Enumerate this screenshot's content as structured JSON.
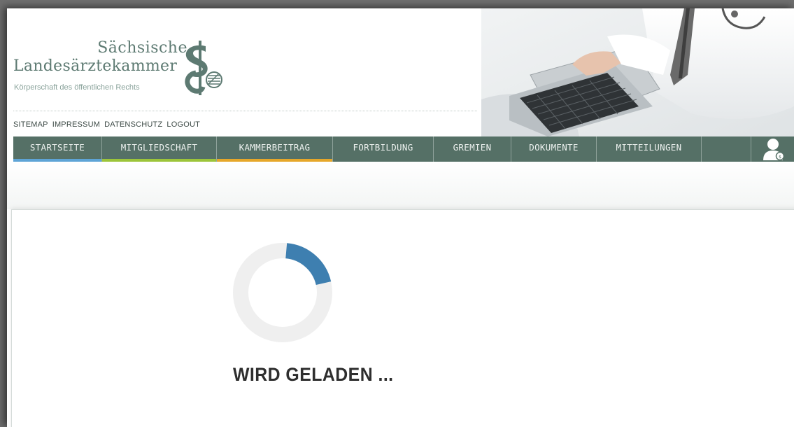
{
  "brand": {
    "line1": "Sächsische",
    "line2": "Landesärztekammer",
    "subtitle": "Körperschaft des öffentlichen Rechts"
  },
  "utility_nav": [
    {
      "label": "SITEMAP"
    },
    {
      "label": "IMPRESSUM"
    },
    {
      "label": "DATENSCHUTZ"
    },
    {
      "label": "LOGOUT"
    }
  ],
  "main_nav": [
    {
      "label": "STARTSEITE",
      "accent": "#5ea4d6"
    },
    {
      "label": "MITGLIEDSCHAFT",
      "accent": "#9cc43a"
    },
    {
      "label": "KAMMERBEITRAG",
      "accent": "#e6a72a"
    },
    {
      "label": "FORTBILDUNG",
      "accent": ""
    },
    {
      "label": "GREMIEN",
      "accent": ""
    },
    {
      "label": "DOKUMENTE",
      "accent": ""
    },
    {
      "label": "MITTEILUNGEN",
      "accent": ""
    }
  ],
  "user_menu": {
    "icon": "user-profile-icon"
  },
  "loading": {
    "text": "WIRD GELADEN ...",
    "progress": 0.2,
    "color": "#3e7fb0",
    "track_color": "#efefef"
  },
  "colors": {
    "nav_background": "#557066",
    "brand_green": "#5d7a72"
  }
}
